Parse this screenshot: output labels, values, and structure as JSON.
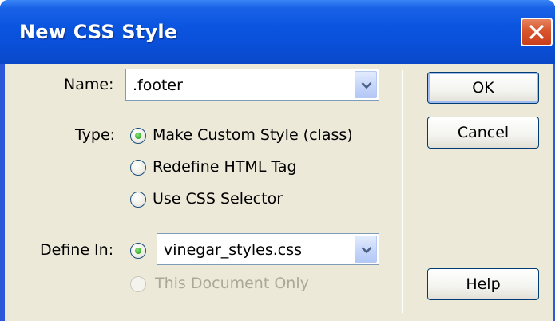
{
  "window": {
    "title": "New CSS Style"
  },
  "form": {
    "name_label": "Name:",
    "name_value": ".footer",
    "type_label": "Type:",
    "type_options": [
      "Make Custom Style (class)",
      "Redefine HTML Tag",
      "Use CSS Selector"
    ],
    "type_selected": "Make Custom Style (class)",
    "define_in_label": "Define In:",
    "define_in_value": "vinegar_styles.css",
    "this_document_only": "This Document Only"
  },
  "buttons": {
    "ok": "OK",
    "cancel": "Cancel",
    "help": "Help"
  },
  "icons": {
    "close": "close-icon",
    "dropdown": "chevron-down-icon"
  },
  "colors": {
    "title_bar": "#0a55e0",
    "client": "#ece9d8",
    "close": "#d9552c",
    "radio_selected": "#35ad26"
  }
}
